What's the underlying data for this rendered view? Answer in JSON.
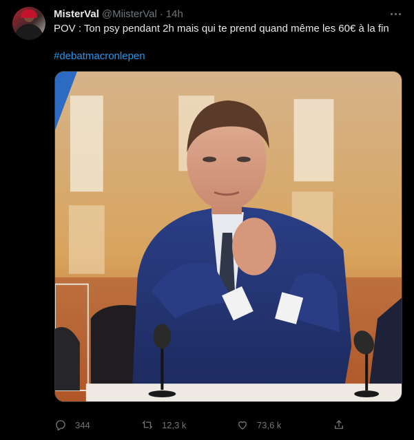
{
  "tweet": {
    "author": {
      "name": "MisterVal",
      "handle": "@MiisterVal",
      "separator": "·",
      "time": "14h"
    },
    "text": "POV : Ton psy pendant 2h mais qui te prend quand même les 60€ à la fin",
    "hashtag": "#debatmacronlepen",
    "actions": {
      "replies": "344",
      "retweets": "12,3 k",
      "likes": "73,6 k"
    }
  },
  "colors": {
    "background": "#000000",
    "text": "#e7e9ea",
    "muted": "#71767b",
    "link": "#1d9bf0"
  },
  "icons": [
    "more-icon",
    "reply-icon",
    "retweet-icon",
    "like-icon",
    "share-icon"
  ]
}
